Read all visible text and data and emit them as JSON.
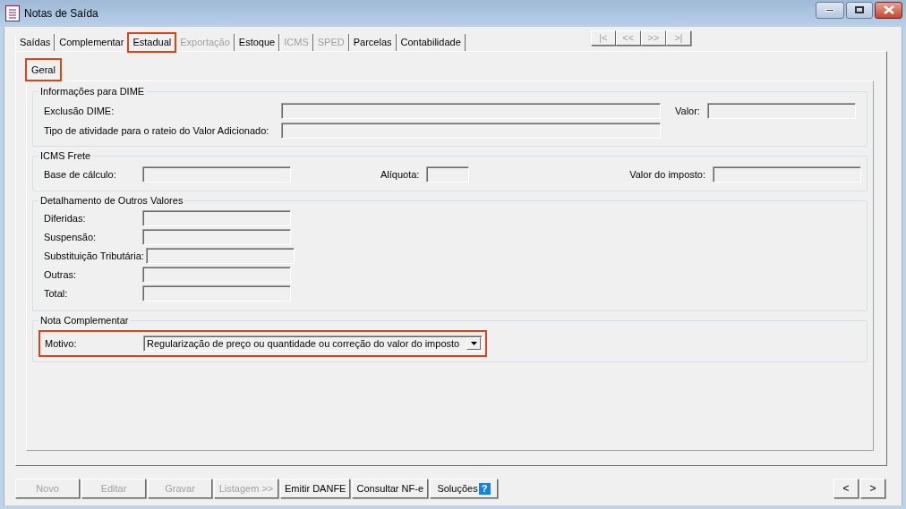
{
  "window": {
    "title": "Notas de Saída"
  },
  "tabs": [
    {
      "label": "Saídas",
      "selected": false,
      "disabled": false,
      "highlighted": false
    },
    {
      "label": "Complementar",
      "selected": false,
      "disabled": false,
      "highlighted": false
    },
    {
      "label": "Estadual",
      "selected": true,
      "disabled": false,
      "highlighted": true
    },
    {
      "label": "Exportação",
      "selected": false,
      "disabled": true,
      "highlighted": false
    },
    {
      "label": "Estoque",
      "selected": false,
      "disabled": false,
      "highlighted": false
    },
    {
      "label": "ICMS",
      "selected": false,
      "disabled": true,
      "highlighted": false
    },
    {
      "label": "SPED",
      "selected": false,
      "disabled": true,
      "highlighted": false
    },
    {
      "label": "Parcelas",
      "selected": false,
      "disabled": false,
      "highlighted": false
    },
    {
      "label": "Contabilidade",
      "selected": false,
      "disabled": false,
      "highlighted": false
    }
  ],
  "record_nav": [
    {
      "label": "|<",
      "disabled": true
    },
    {
      "label": "<<",
      "disabled": true
    },
    {
      "label": ">>",
      "disabled": true
    },
    {
      "label": ">|",
      "disabled": true
    }
  ],
  "subtabs": [
    {
      "label": "Geral",
      "selected": true,
      "highlighted": true
    }
  ],
  "groups": [
    {
      "kind": "dime",
      "title": "Informações para DIME",
      "fields": [
        {
          "label": "Exclusão DIME:",
          "disabled": true
        },
        {
          "label": "Valor:",
          "disabled": true
        },
        {
          "label": "Tipo de atividade para o rateio do Valor Adicionado:",
          "disabled": true
        }
      ]
    },
    {
      "kind": "frete",
      "title": "ICMS Frete",
      "fields": [
        {
          "label": "Base de cálculo:",
          "disabled": true
        },
        {
          "label": "Alíquota:",
          "disabled": true
        },
        {
          "label": "Valor do imposto:",
          "disabled": true
        }
      ]
    },
    {
      "kind": "list",
      "title": "Detalhamento de Outros Valores",
      "fields": [
        {
          "label": "Diferidas:",
          "disabled": true
        },
        {
          "label": "Suspensão:",
          "disabled": true
        },
        {
          "label": "Substituição Tributária:",
          "disabled": true
        },
        {
          "label": "Outras:",
          "disabled": true
        },
        {
          "label": "Total:",
          "disabled": true
        }
      ]
    },
    {
      "kind": "select",
      "title": "Nota Complementar",
      "fields": [
        {
          "label": "Motivo:",
          "value": "Regularização de preço ou quantidade ou correção do valor do imposto",
          "disabled": false,
          "highlighted": true
        }
      ]
    }
  ],
  "buttons": [
    {
      "label": "Novo",
      "disabled": true
    },
    {
      "label": "Editar",
      "disabled": true
    },
    {
      "label": "Gravar",
      "disabled": true
    },
    {
      "label": "Listagem >>",
      "disabled": true
    },
    {
      "label": "Emitir DANFE",
      "disabled": false
    },
    {
      "label": "Consultar NF-e",
      "disabled": false
    },
    {
      "label": "Soluções",
      "disabled": false,
      "help": "?"
    }
  ],
  "pager": [
    {
      "label": "<"
    },
    {
      "label": ">"
    }
  ]
}
